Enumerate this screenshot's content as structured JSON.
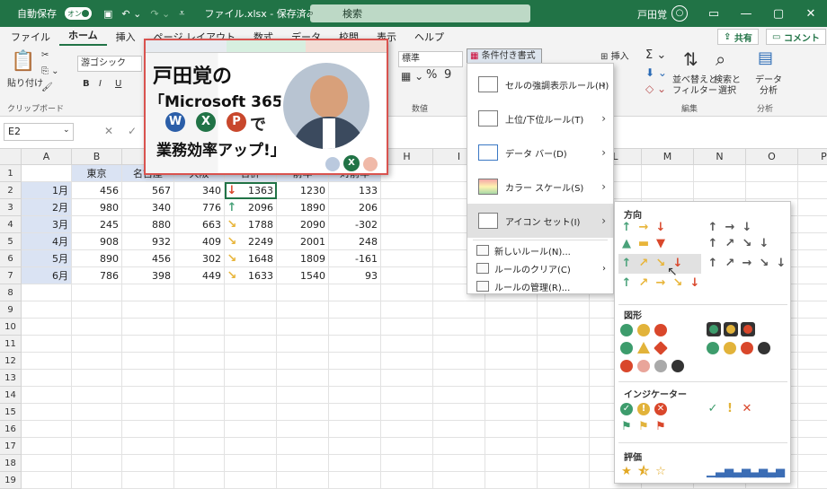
{
  "titlebar": {
    "autosave_label": "自動保存",
    "autosave_state": "オン",
    "filename": "ファイル.xlsx - 保存済み",
    "search_placeholder": "検索",
    "user_name": "戸田覚"
  },
  "tabs": [
    "ファイル",
    "ホーム",
    "挿入",
    "ページ レイアウト",
    "数式",
    "データ",
    "校閲",
    "表示",
    "ヘルプ"
  ],
  "share_label": "共有",
  "comment_label": "コメント",
  "ribbon": {
    "paste_label": "貼り付け",
    "clipboard_label": "クリップボード",
    "font_name": "游ゴシック",
    "number_format": "標準",
    "number_group": "数値",
    "cond_format_label": "条件付き書式",
    "insert_label": "挿入",
    "sort_filter_label": "並べ替えと\nフィルター",
    "find_select_label": "検索と\n選択",
    "edit_group": "編集",
    "analyze_label": "データ\n分析",
    "analyze_group": "分析"
  },
  "namebox": "E2",
  "columns": [
    "A",
    "B",
    "C",
    "D",
    "E",
    "F",
    "G",
    "H",
    "I",
    "J",
    "K",
    "L",
    "M",
    "N",
    "O",
    "P"
  ],
  "rows": [
    "1",
    "2",
    "3",
    "4",
    "5",
    "6",
    "7",
    "8",
    "9",
    "10",
    "11",
    "12",
    "13",
    "14",
    "15",
    "16",
    "17",
    "18",
    "19"
  ],
  "table": {
    "headers": [
      "東京",
      "名古屋",
      "大阪",
      "合計",
      "前年",
      "対前年"
    ],
    "rows": [
      {
        "label": "1月",
        "v": [
          "456",
          "567",
          "340",
          "1363",
          "1230",
          "133"
        ],
        "arrow": "down"
      },
      {
        "label": "2月",
        "v": [
          "980",
          "340",
          "776",
          "2096",
          "1890",
          "206"
        ],
        "arrow": "up"
      },
      {
        "label": "3月",
        "v": [
          "245",
          "880",
          "663",
          "1788",
          "2090",
          "-302"
        ],
        "arrow": "diag-down"
      },
      {
        "label": "4月",
        "v": [
          "908",
          "932",
          "409",
          "2249",
          "2001",
          "248"
        ],
        "arrow": "diag-down"
      },
      {
        "label": "5月",
        "v": [
          "890",
          "456",
          "302",
          "1648",
          "1809",
          "-161"
        ],
        "arrow": "diag-down"
      },
      {
        "label": "6月",
        "v": [
          "786",
          "398",
          "449",
          "1633",
          "1540",
          "93"
        ],
        "arrow": "diag-down"
      }
    ]
  },
  "overlay": {
    "line1": "戸田覚の",
    "line2": "「Microsoft 365",
    "line3": "で",
    "line4": "業務効率アップ!」",
    "badges": [
      "W",
      "X",
      "P"
    ]
  },
  "menu": {
    "items": [
      "セルの強調表示ルール(H)",
      "上位/下位ルール(T)",
      "データ バー(D)",
      "カラー スケール(S)",
      "アイコン セット(I)"
    ],
    "small": [
      "新しいルール(N)...",
      "ルールのクリア(C)",
      "ルールの管理(R)..."
    ]
  },
  "submenu": {
    "direction": "方向",
    "shapes": "図形",
    "indicators": "インジケーター",
    "rating": "評価"
  },
  "colors": {
    "green": "#217346",
    "arrow_green": "#4aa27a",
    "arrow_yellow": "#e8b53a",
    "arrow_red": "#d9472b",
    "arrow_gray": "#555555",
    "cell_blue": "#dae3f3"
  }
}
